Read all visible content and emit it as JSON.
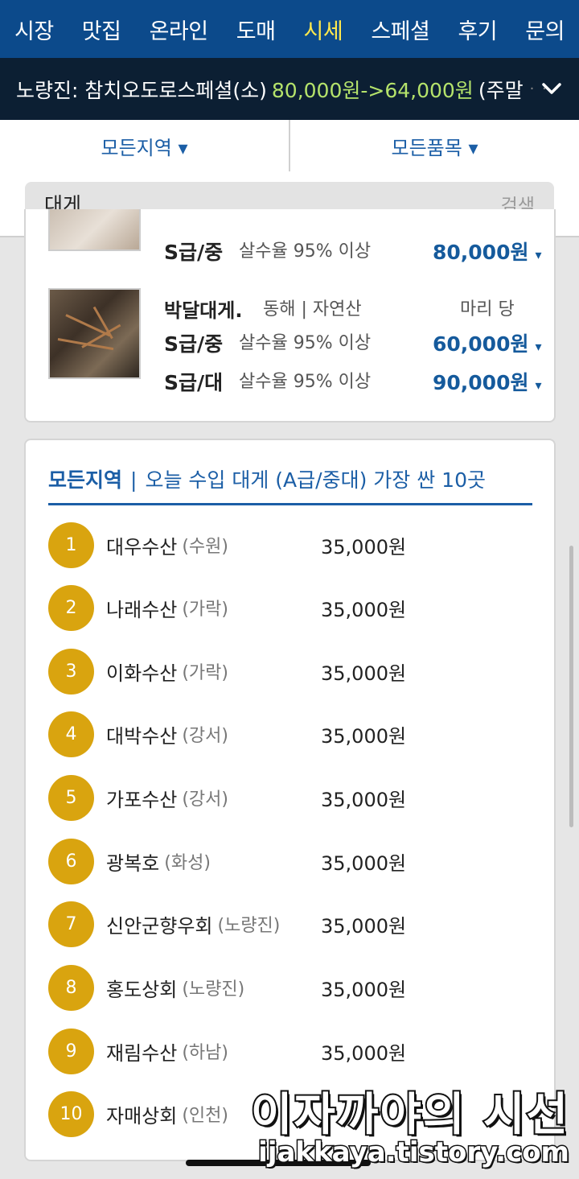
{
  "nav": {
    "items": [
      "시장",
      "맛집",
      "온라인",
      "도매",
      "시세",
      "스페셜",
      "후기",
      "문의"
    ],
    "active_index": 4
  },
  "ticker": {
    "label": "노량진: 참치오도로스페셜(소)",
    "price": "80,000원->64,000원",
    "note": "(주말",
    "dots": "· · ·"
  },
  "filters": {
    "region": "모든지역 ▾",
    "category": "모든품목 ▾"
  },
  "search": {
    "value": "대게",
    "button": "검색"
  },
  "listing": {
    "top_row": {
      "grade": "S급/중",
      "survival": "살수율 95% 이상",
      "price": "80,000원"
    },
    "product": {
      "name": "박달대게.",
      "origin": "동해 | 자연산",
      "unit": "마리 당",
      "rows": [
        {
          "grade": "S급/중",
          "survival": "살수율 95% 이상",
          "price": "60,000원"
        },
        {
          "grade": "S급/대",
          "survival": "살수율 95% 이상",
          "price": "90,000원"
        }
      ]
    },
    "dropdown_mark": "▾"
  },
  "ranking": {
    "region": "모든지역",
    "separator": "|",
    "title": "오늘 수입 대게 (A급/중대) 가장 싼 10곳",
    "rows": [
      {
        "rank": "1",
        "name": "대우수산",
        "location": "(수원)",
        "price": "35,000원"
      },
      {
        "rank": "2",
        "name": "나래수산",
        "location": "(가락)",
        "price": "35,000원"
      },
      {
        "rank": "3",
        "name": "이화수산",
        "location": "(가락)",
        "price": "35,000원"
      },
      {
        "rank": "4",
        "name": "대박수산",
        "location": "(강서)",
        "price": "35,000원"
      },
      {
        "rank": "5",
        "name": "가포수산",
        "location": "(강서)",
        "price": "35,000원"
      },
      {
        "rank": "6",
        "name": "광복호",
        "location": "(화성)",
        "price": "35,000원"
      },
      {
        "rank": "7",
        "name": "신안군향우회",
        "location": "(노량진)",
        "price": "35,000원"
      },
      {
        "rank": "8",
        "name": "홍도상회",
        "location": "(노량진)",
        "price": "35,000원"
      },
      {
        "rank": "9",
        "name": "재림수산",
        "location": "(하남)",
        "price": "35,000원"
      },
      {
        "rank": "10",
        "name": "자매상회",
        "location": "(인천)",
        "price": ""
      }
    ]
  },
  "watermark": {
    "title": "이자까야의 시선",
    "url": "ijakkaya.tistory.com"
  },
  "colors": {
    "nav_bg": "#0c4a8b",
    "nav_active": "#ffe94d",
    "ticker_bg": "#0c1f33",
    "ticker_price": "#b5e36b",
    "accent_blue": "#1b5ea6",
    "rank_badge": "#d9a40f"
  }
}
